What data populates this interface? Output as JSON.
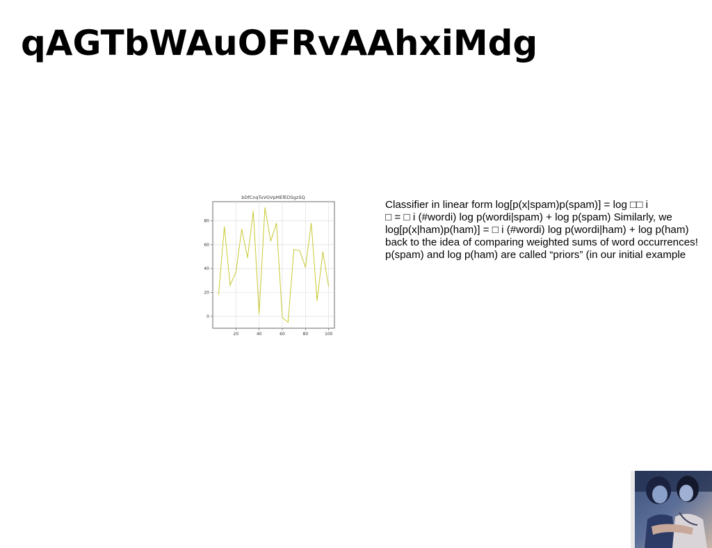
{
  "slide": {
    "title": "qAGTbWAuOFRvAAhxiMdg"
  },
  "text_block": {
    "lines": [
      "Classifier in linear form log[p(x|spam)p(spam)] = log □□ i",
      "□ = □ i (#wordi) log p(wordi|spam) + log p(spam) Similarly, we",
      "log[p(x|ham)p(ham)] = □ i (#wordi) log p(wordi|ham) + log p(ham)",
      "back to the idea of comparing weighted sums of word occurrences!",
      "p(spam) and log p(ham) are called “priors” (in our initial example"
    ]
  },
  "photo": {
    "description_icon": "people-photo"
  },
  "chart_data": {
    "type": "line",
    "title": "bDfCnqTuVGVpMEfEDSgzSQ",
    "xlabel": "",
    "ylabel": "",
    "x": [
      5,
      10,
      15,
      20,
      25,
      30,
      35,
      40,
      45,
      50,
      55,
      60,
      65,
      70,
      75,
      80,
      85,
      90,
      95,
      100
    ],
    "series": [
      {
        "values": [
          18,
          75,
          26,
          37,
          73,
          49,
          88,
          2,
          91,
          63,
          78,
          -1,
          -5,
          56,
          55,
          41,
          78,
          13,
          54,
          25
        ],
        "color": "#c8c832"
      }
    ],
    "xlim": [
      0,
      105
    ],
    "ylim": [
      -10,
      96
    ],
    "xticks": [
      20,
      40,
      60,
      80,
      100
    ],
    "yticks": [
      0,
      20,
      40,
      60,
      80
    ],
    "grid": true,
    "legend": "none"
  }
}
